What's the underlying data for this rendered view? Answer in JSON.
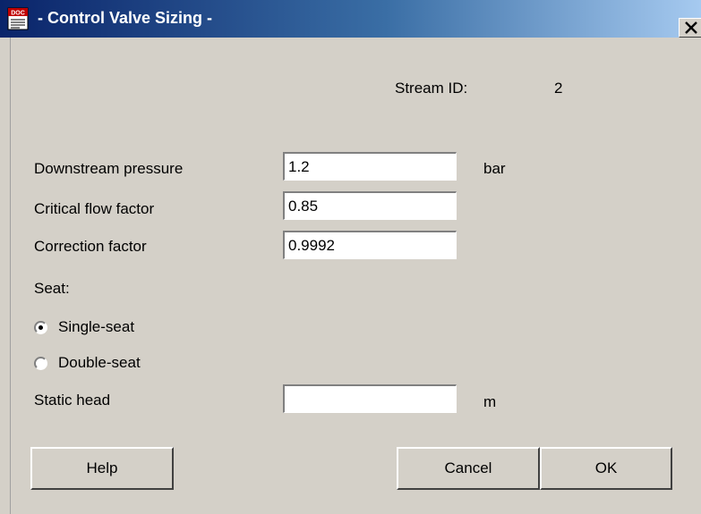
{
  "window": {
    "title": "- Control Valve Sizing -",
    "icon": "doc-icon",
    "close_label": "X"
  },
  "stream": {
    "label": "Stream ID:",
    "value": "2"
  },
  "fields": [
    {
      "label": "Downstream pressure",
      "value": "1.2",
      "unit": "bar"
    },
    {
      "label": "Critical flow factor",
      "value": "0.85",
      "unit": ""
    },
    {
      "label": "Correction factor",
      "value": "0.9992",
      "unit": ""
    }
  ],
  "seat": {
    "label": "Seat:",
    "options": [
      {
        "label": "Single-seat",
        "selected": true
      },
      {
        "label": "Double-seat",
        "selected": false
      }
    ]
  },
  "static_head": {
    "label": "Static head",
    "value": "",
    "unit": "m"
  },
  "buttons": {
    "help": "Help",
    "cancel": "Cancel",
    "ok": "OK"
  },
  "colors": {
    "dialog_bg": "#d4d0c8",
    "title_start": "#0a246a",
    "title_end": "#a6caf0"
  }
}
